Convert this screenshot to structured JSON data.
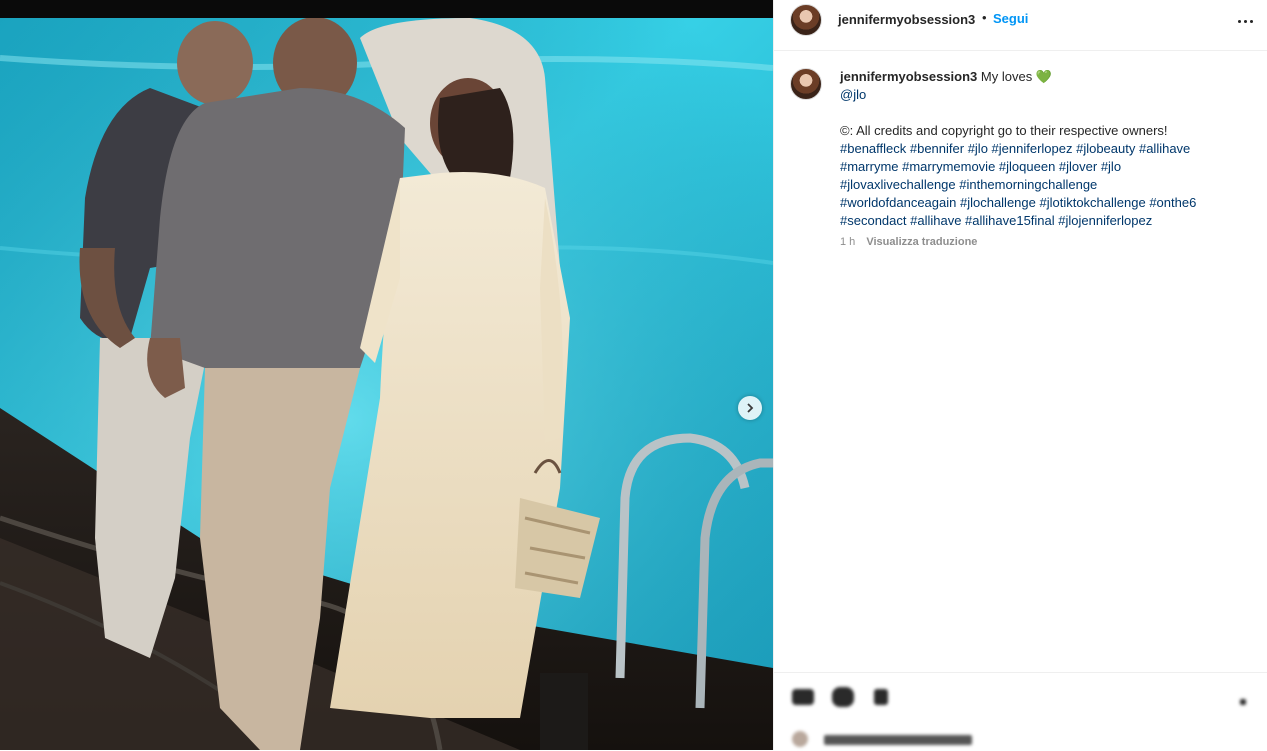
{
  "post": {
    "username": "jennifermyobsession3",
    "dot": "•",
    "follow_label": "Segui",
    "caption_text": "My loves",
    "caption_emoji": "💚",
    "mention": "@jlo",
    "credit_line": "©: All credits and copyright go to their respective owners!",
    "hashtags": [
      "#benaffleck",
      "#bennifer",
      "#jlo",
      "#jenniferlopez",
      "#jlobeauty",
      "#allihave",
      "#marryme",
      "#marrymemovie",
      "#jloqueen",
      "#jlover",
      "#jlo",
      "#jlovaxlivechallenge",
      "#inthemorningchallenge",
      "#worldofdanceagain",
      "#jlochallenge",
      "#jlotiktokchallenge",
      "#onthe6",
      "#secondact",
      "#allihave",
      "#allihave15final",
      "#jlojenniferlopez"
    ],
    "hashtag_lines": [
      "#benaffleck #bennifer #jlo #jenniferlopez #jlobeauty #allihave",
      "#marryme #marrymemovie #jloqueen #jlover #jlo",
      "#jlovaxlivechallenge #inthemorningchallenge",
      "#worldofdanceagain #jlochallenge #jlotiktokchallenge #onthe6",
      "#secondact #allihave #allihave15final #jlojenniferlopez"
    ],
    "time_ago": "1 h",
    "translate_label": "Visualizza traduzione"
  },
  "icons": {
    "more": "more-options-icon",
    "next": "chevron-right-icon",
    "heart": "green-heart-emoji"
  },
  "colors": {
    "link": "#00376b",
    "follow": "#0095f6",
    "pool": "#29c4dd",
    "dress": "#efe4cc"
  }
}
